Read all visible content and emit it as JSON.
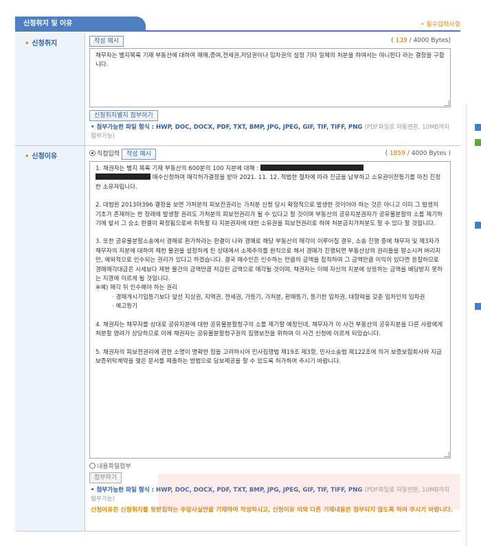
{
  "header": {
    "tab_title": "신청취지 및 이유",
    "required_note": "• 필수입력사항"
  },
  "purpose": {
    "label": "신청취지",
    "example_button": "작성 예시",
    "counter_open": "( ",
    "count": "139",
    "counter_close": " / 4000 Bytes)",
    "text": "채무자는 별지목록 기재 부동산에 대하여 매매,증여,전세권,저당권이나 임차권의 설정 기타 일체의 처분을 하여서는 아니된다 라는 결정을 구합니다.",
    "attach_button": "신청취지별지 첨부하기",
    "file_note": "• 첨부가능한 파일 형식 : HWP, DOC, DOCX, PDF, TXT, BMP, JPG, JPEG, GIF, TIF, TIFF, PNG",
    "file_note_light": "(PDF파일로 자동변환, 10MB까지 첨부가능)"
  },
  "reason": {
    "label": "신청이유",
    "direct_input": "직접입력",
    "example_button": "작성 예시",
    "counter_open": "( ",
    "count": "1859",
    "counter_close": " / 4000 Bytes )",
    "paragraphs": [
      "1. 채권자는 별지 목록 기재 부동산의 600분의 100 지분에 대해 :",
      "매수신청하여 매각허가결정을 받아 2021. 11. 12. 적법한 절차에 따라 잔금을 납부하고 소유권이전등기를 마친 진정한 소유자입니다.",
      "2. 대법원 2013마396 결정을 보면 가처분의 피보전권리는 가처분 신청 당시 확정적으로 발생한 것이어야 하는 것은 아니고 이미 그 발생의 기초가 존재하는 한 장래에 발생할 권리도 가처분의 피보전권리가 될 수 있다고 할 것이며 부동산의 공유지분권자가 공유물분할의 소를 제기하기에 앞서 그 승소 판결이 확정됨으로써 취득할 타 지분권자에 대한 소유권을 피보전권리로 하여 처분금지가처분도 할 수 있다 할 것입니다.",
      "3. 또한 공유물분할소송에서 경매로 환가하라는 판결이 나와 경매로 해당 부동산의 매각이 이루어질 경우, 소송 진행 중에 채무자 및 제3자가 채무자의 지분에 대하여 제한 물권을 설정하게 된 상태에서 소제주의를 원칙으로 해서 경매가 진행되면 부동산상의 권리들을 말소시켜 버리지만, 예외적으로 인수되는 권리가 있다고 하겠습니다. 결국 매수인은 인수하는 만큼의 금액을 참작하여 그 금액만큼 이익이 있다면 응찰하므로 경매매각대금은 시세보다 제한 물건의 금액만큼 저감된 금액으로 매각될 것이며, 채권자는 이때 자신의 지분에 상응하는 금액을 배당받지 못하는 지경에 이르게 될 것입니다.",
      "※예) 매각 뒤 인수해야 하는 권리",
      "· 경매개시기입등기보다 앞선 지상권, 지역권, 전세권, 가등기, 가처분, 환매등기, 등기한 임차권, 대항력을 갖춘 임차인의 임차권",
      "· 예고등기",
      "4. 채권자는 채무자를 상대로 공유지분에 대한 공유물분할청구의 소를 제기할 예정인데, 채무자가 이 사건 부동산의 공유지분을 다른 사람에게 처분할 염려가 상당하므로 이에 채권자는 공유물분할청구권의 집행보전을 위하여 이 사건 신청에 이르게 되었습니다.",
      "5. 채권자의 피보전권리에 관한 소명이 명확한 점을 고려하시어 민사집행법 제19조 제3항, 민사소송법 제122조에 의거 보증보험회사와 지급보증위탁계약을 맺은 문서를 제출하는 방법으로 담보제공을 할 수 있도록 허가하여 주시기 바랍니다."
    ],
    "file_attach_option": "내용파일첨부",
    "attach_button": "첨부하기",
    "file_note": "• 첨부가능한 파일 형식 : HWP, DOC, DOCX, PDF, TXT, BMP, JPG, JPEG, GIF, TIF, TIFF, PNG",
    "file_note_light": "(PDF파일로 자동변환, 10MB까지 첨부가능)",
    "warning": "신청이유은 신청취지를 뒷받침하는 주장사실만을 기재하여 작성하시고, 신청이유 이외 다른 기재내용은 첨부되지 않도록 하여 주시기 바랍니다."
  },
  "colors": {
    "accent": "#4f7fc0",
    "required": "#e08a00",
    "label_bg": "#edf3fb"
  }
}
